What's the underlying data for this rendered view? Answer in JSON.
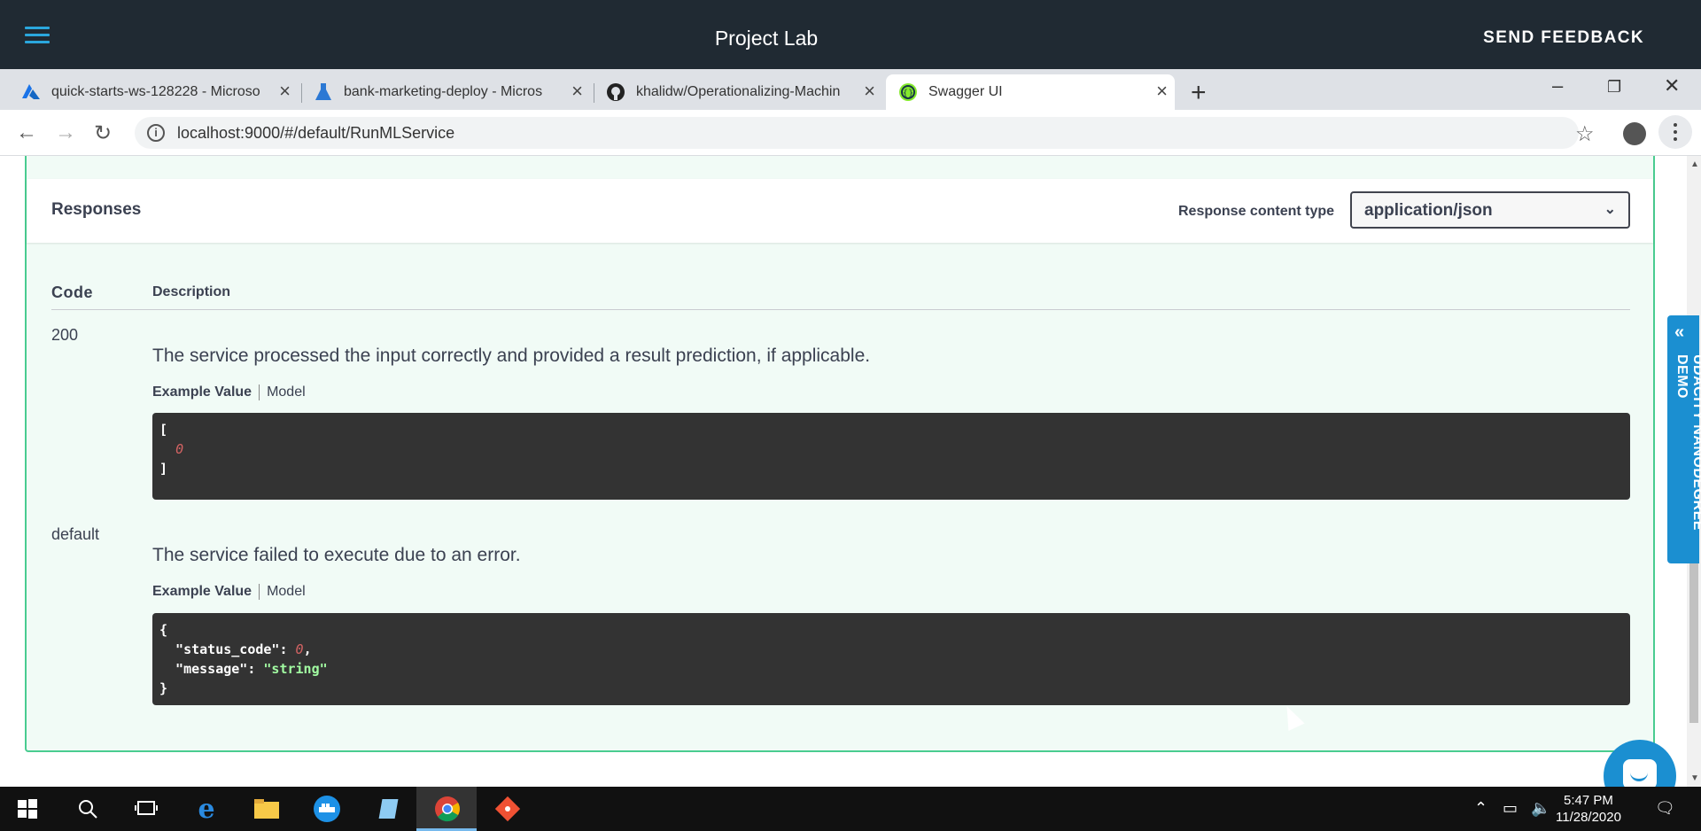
{
  "appbar": {
    "title": "Project Lab",
    "feedback": "SEND FEEDBACK"
  },
  "tabs": [
    {
      "title": "quick-starts-ws-128228 - Microso",
      "icon": "azure-icon"
    },
    {
      "title": "bank-marketing-deploy - Micros",
      "icon": "azure-ml-icon"
    },
    {
      "title": "khalidw/Operationalizing-Machin",
      "icon": "github-icon"
    },
    {
      "title": "Swagger UI",
      "icon": "swagger-icon",
      "active": true
    }
  ],
  "address": {
    "url": "localhost:9000/#/default/RunMLService"
  },
  "responses": {
    "heading": "Responses",
    "content_type_label": "Response content type",
    "content_type_value": "application/json",
    "col_code": "Code",
    "col_description": "Description",
    "example_value_label": "Example Value",
    "model_label": "Model",
    "rows": [
      {
        "code": "200",
        "description": "The service processed the input correctly and provided a result prediction, if applicable."
      },
      {
        "code": "default",
        "description": "The service failed to execute due to an error."
      }
    ]
  },
  "ribbon": {
    "label": "UDACITY NANODEGREE DEMO"
  },
  "clock": {
    "time": "5:47 PM",
    "date": "11/28/2020"
  },
  "colors": {
    "accent_green": "#49cc90",
    "appbar_bg": "#202a33",
    "ribbon_blue": "#1b8fd1"
  }
}
